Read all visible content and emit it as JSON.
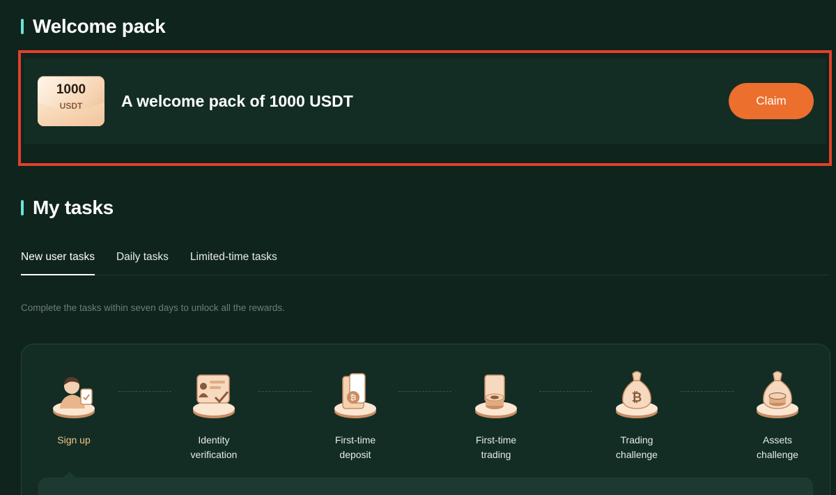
{
  "welcome": {
    "title": "Welcome pack",
    "voucher_amount": "1000",
    "voucher_unit": "USDT",
    "description": "A welcome pack of 1000 USDT",
    "claim_label": "Claim"
  },
  "tasks": {
    "title": "My tasks",
    "tabs": [
      {
        "label": "New user tasks",
        "active": true
      },
      {
        "label": "Daily tasks",
        "active": false
      },
      {
        "label": "Limited-time tasks",
        "active": false
      }
    ],
    "hint": "Complete the tasks within seven days to unlock all the rewards.",
    "steps": [
      {
        "label": "Sign up",
        "icon": "user-signup-icon",
        "status": "done"
      },
      {
        "label": "Identity verification",
        "icon": "id-card-icon",
        "status": "pending"
      },
      {
        "label": "First-time deposit",
        "icon": "bitcoin-wallet-icon",
        "status": "pending"
      },
      {
        "label": "First-time trading",
        "icon": "coin-stack-icon",
        "status": "pending"
      },
      {
        "label": "Trading challenge",
        "icon": "money-bag-icon",
        "status": "pending"
      },
      {
        "label": "Assets challenge",
        "icon": "money-bag-coins-icon",
        "status": "pending"
      }
    ]
  },
  "colors": {
    "background": "#0f241d",
    "card": "#132d25",
    "accent_bar": "#6be3d8",
    "claim_button": "#ec6f2d",
    "highlight_border": "#e2402b",
    "done_label": "#f2c785"
  }
}
